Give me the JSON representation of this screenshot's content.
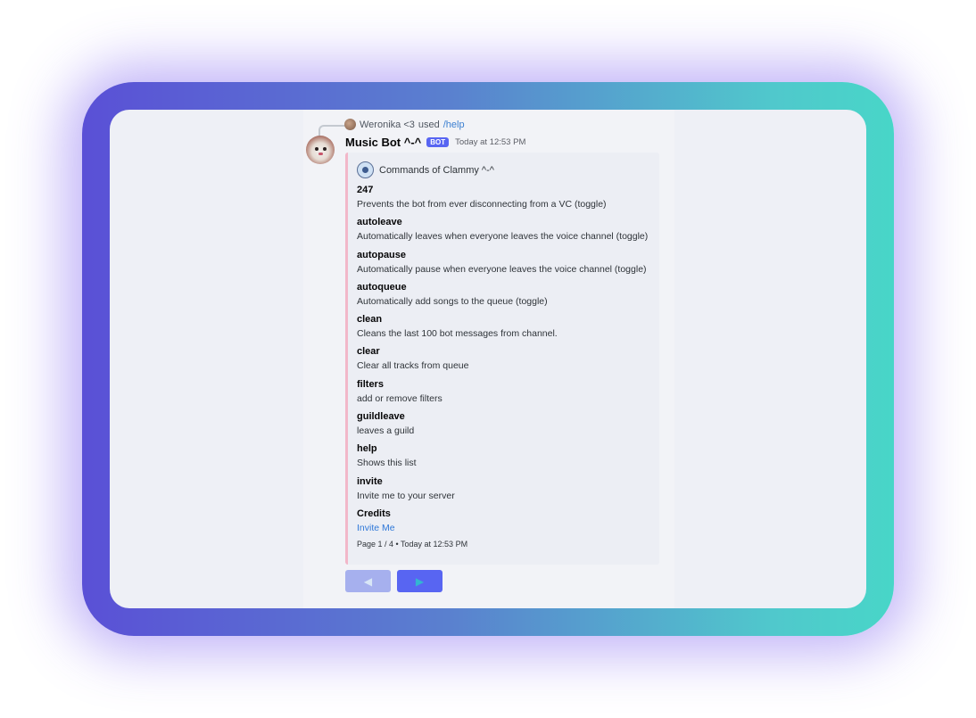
{
  "reply": {
    "user": "Weronika <3",
    "used": "used",
    "command": "/help"
  },
  "message": {
    "username": "Music Bot ^-^",
    "bot_tag": "BOT",
    "timestamp": "Today at 12:53 PM"
  },
  "embed": {
    "author": "Commands of Clammy ^-^",
    "border_color": "#f2b7c9",
    "fields": [
      {
        "name": "247",
        "value": "Prevents the bot from ever disconnecting from a VC (toggle)"
      },
      {
        "name": "autoleave",
        "value": "Automatically leaves when everyone leaves the voice channel (toggle)"
      },
      {
        "name": "autopause",
        "value": "Automatically pause when everyone leaves the voice channel (toggle)"
      },
      {
        "name": "autoqueue",
        "value": "Automatically add songs to the queue (toggle)"
      },
      {
        "name": "clean",
        "value": "Cleans the last 100 bot messages from channel."
      },
      {
        "name": "clear",
        "value": "Clear all tracks from queue"
      },
      {
        "name": "filters",
        "value": "add or remove filters"
      },
      {
        "name": "guildleave",
        "value": "leaves a guild"
      },
      {
        "name": "help",
        "value": "Shows this list"
      },
      {
        "name": "invite",
        "value": "Invite me to your server"
      },
      {
        "name": "Credits",
        "value": "Invite Me"
      }
    ],
    "footer": "Page 1 / 4 • Today at 12:53 PM"
  },
  "buttons": {
    "prev": "◀",
    "next": "▶"
  },
  "icons": {
    "reply_avatar": "user-avatar-icon",
    "bot_avatar": "bot-avatar-icon",
    "author": "music-disc-icon"
  },
  "colors": {
    "accent": "#5865f2",
    "link": "#2f78d8"
  }
}
